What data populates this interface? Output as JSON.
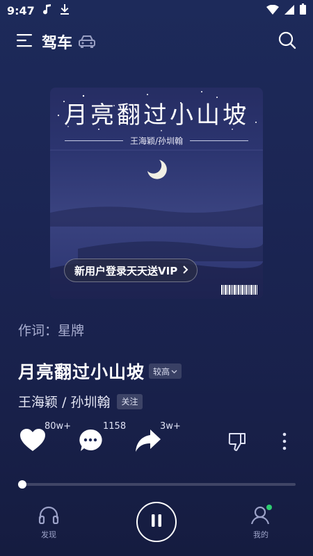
{
  "status_bar": {
    "time": "9:47"
  },
  "top_bar": {
    "title": "驾车"
  },
  "cover": {
    "title": "月亮翻过小山坡",
    "artists": "王海颖/孙圳翰",
    "vip_banner": "新用户登录天天送VIP"
  },
  "lyricist": "作词：星牌",
  "song": {
    "title": "月亮翻过小山坡",
    "quality": "较高"
  },
  "artist": {
    "name": "王海颖 / 孙圳翰",
    "follow": "关注"
  },
  "actions": {
    "like_count": "80w+",
    "comment_count": "1158",
    "share_count": "3w+"
  },
  "progress": {
    "fraction": 0.0
  },
  "bottom_nav": {
    "discover": "发现",
    "mine": "我的"
  },
  "colors": {
    "background": "#1b2553",
    "accent": "#ffffff",
    "notification_dot": "#2ecc71"
  }
}
